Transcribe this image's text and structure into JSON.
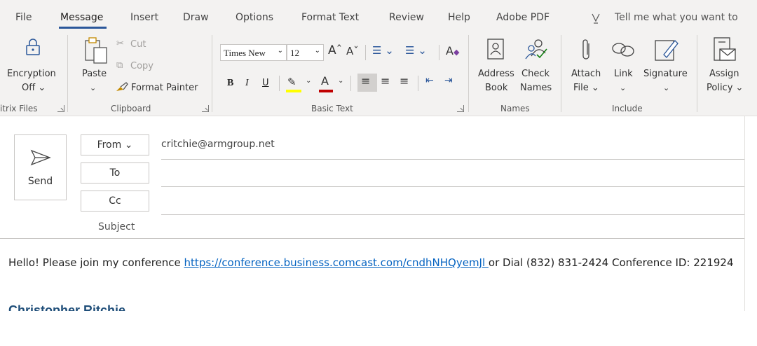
{
  "menu": {
    "tabs": [
      {
        "label": "File"
      },
      {
        "label": "Message"
      },
      {
        "label": "Insert"
      },
      {
        "label": "Draw"
      },
      {
        "label": "Options"
      },
      {
        "label": "Format Text"
      },
      {
        "label": "Review"
      },
      {
        "label": "Help"
      },
      {
        "label": "Adobe PDF"
      }
    ],
    "tell_me": "Tell me what you want to"
  },
  "ribbon": {
    "encryption": {
      "line1": "Encryption",
      "line2": "Off ⌄",
      "group": "itrix Files"
    },
    "clipboard": {
      "paste": "Paste",
      "cut": "Cut",
      "copy": "Copy",
      "format_painter": "Format Painter",
      "group": "Clipboard"
    },
    "basic_text": {
      "font": "Times New",
      "size": "12",
      "bold": "B",
      "italic": "I",
      "underline": "U",
      "group": "Basic Text"
    },
    "names": {
      "address_book_1": "Address",
      "address_book_2": "Book",
      "check_names_1": "Check",
      "check_names_2": "Names",
      "group": "Names"
    },
    "include": {
      "attach_1": "Attach",
      "attach_2": "File ⌄",
      "link": "Link",
      "signature": "Signature",
      "group": "Include"
    },
    "policy": {
      "line1": "Assign",
      "line2": "Policy ⌄"
    }
  },
  "compose": {
    "send": "Send",
    "from_label": "From ⌄",
    "from_value": "critchie@armgroup.net",
    "to_label": "To",
    "cc_label": "Cc",
    "subject_label": "Subject"
  },
  "body": {
    "prefix": "Hello! Please join my conference ",
    "link": "https://conference.business.comcast.com/cndhNHQyemJl ",
    "suffix": "or Dial (832) 831-2424 Conference ID: 221924",
    "signature_name": "Christopher Ritchie"
  },
  "colors": {
    "accent": "#2b579a",
    "link": "#0563c1",
    "highlight": "#ffff00",
    "font_color": "#c00000"
  }
}
